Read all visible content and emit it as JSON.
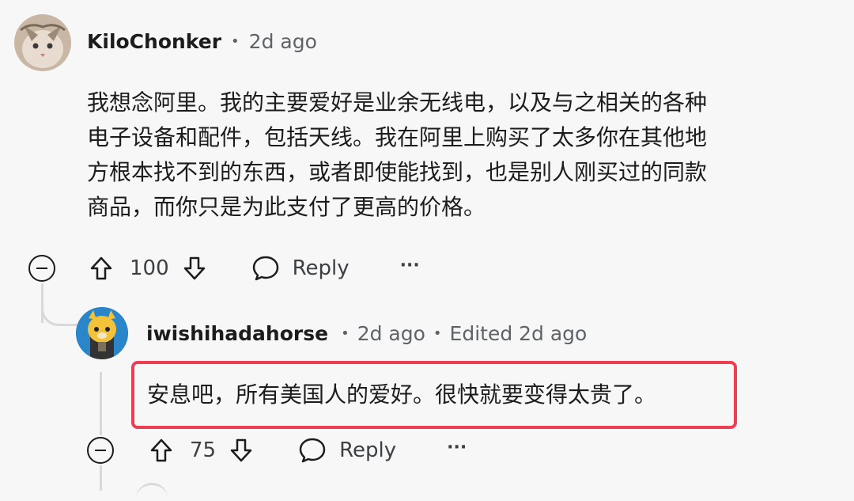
{
  "comment1": {
    "username": "KiloChonker",
    "time": "2d ago",
    "body_lines": [
      "我想念阿里。我的主要爱好是业余无线电，以及与之相关的各种",
      "电子设备和配件，包括天线。我在阿里上购买了太多你在其他地",
      "方根本找不到的东西，或者即使能找到，也是别人刚买过的同款",
      "商品，而你只是为此支付了更高的价格。"
    ],
    "votes": "100",
    "reply_label": "Reply",
    "more_label": "···"
  },
  "comment2": {
    "username": "iwishihadahorse",
    "time": "2d ago",
    "edited": "Edited 2d ago",
    "body": "安息吧，所有美国人的爱好。很快就要变得太贵了。",
    "votes": "75",
    "reply_label": "Reply",
    "more_label": "···"
  },
  "colors": {
    "highlight": "#ee3e54",
    "background": "#f7f7f8"
  }
}
